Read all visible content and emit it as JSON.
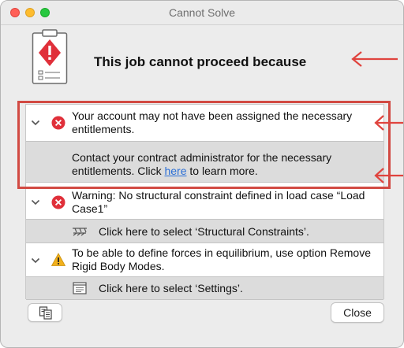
{
  "window": {
    "title": "Cannot Solve"
  },
  "header": {
    "title": "This job cannot proceed because",
    "icon": "clipboard-warning-icon"
  },
  "issues": [
    {
      "severity": "error",
      "icon": "error-x-icon",
      "message": "Your account may not have been assigned the necessary entitlements.",
      "detail_prefix": "Contact your contract administrator for the necessary entitlements. Click ",
      "detail_link": "here",
      "detail_suffix": " to learn more."
    },
    {
      "severity": "error",
      "icon": "error-x-icon",
      "message": "Warning: No structural constraint defined in load case “Load Case1”",
      "action_icon": "structural-constraints-icon",
      "action": "Click here to select ‘Structural Constraints’."
    },
    {
      "severity": "warning",
      "icon": "warning-triangle-icon",
      "message": "To be able to define forces in equilibrium, use option Remove Rigid Body Modes.",
      "action_icon": "settings-window-icon",
      "action": "Click here to select ‘Settings’."
    }
  ],
  "footer": {
    "copy_icon": "copy-icon",
    "close_label": "Close"
  },
  "colors": {
    "annotation": "#e0443e",
    "error": "#e0303a",
    "warning": "#f2b11c",
    "link": "#2b6fd6"
  }
}
